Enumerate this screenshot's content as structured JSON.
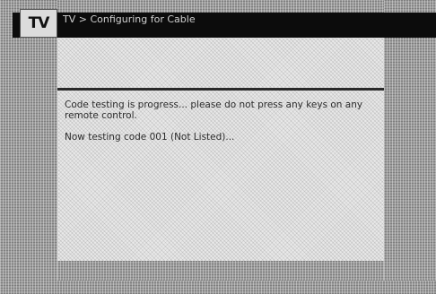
{
  "app": {
    "logo_text": "TV",
    "breadcrumb": "TV > Configuring for Cable"
  },
  "messages": {
    "progress": "Code testing is progress... please do not press any keys on any remote control.",
    "status": "Now testing code 001 (Not Listed)..."
  },
  "colors": {
    "title_bar": "#0c0c0c",
    "panel_background": "#e9e9e9",
    "divider": "#2a2a2a",
    "frame": "#9a9a9a"
  }
}
